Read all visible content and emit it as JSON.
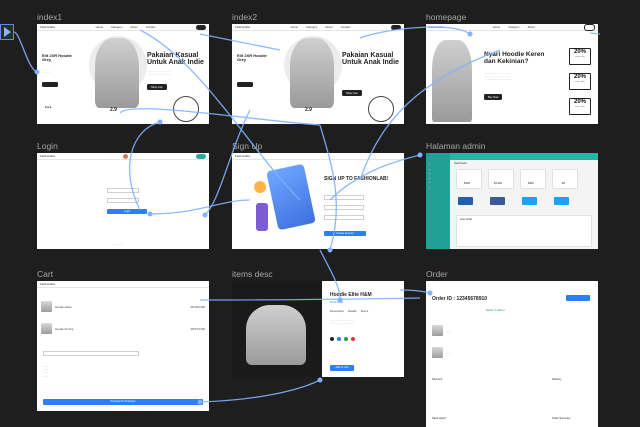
{
  "frames": {
    "index1": {
      "label": "index1"
    },
    "index2": {
      "label": "index2"
    },
    "homepage": {
      "label": "homepage"
    },
    "login": {
      "label": "Login"
    },
    "signup": {
      "label": "Sign Up"
    },
    "admin": {
      "label": "Halaman admin"
    },
    "cart": {
      "label": "Cart"
    },
    "items": {
      "label": "items desc"
    },
    "order": {
      "label": "Order"
    }
  },
  "brand": "Fashionlabs",
  "nav_links": [
    "Home",
    "Category",
    "About",
    "Contact"
  ],
  "hero": {
    "heading": "Pakaian Kasual Untuk Anak Indie",
    "product_small": "Elit 2XR Hoodie Grey",
    "stat_value": "2.9",
    "cta": "Shop now"
  },
  "homepage": {
    "heading": "Nyari Hoodie Keren dan Kekinian?",
    "cta": "Buy Now",
    "badges": [
      {
        "value": "20%",
        "note": "more offer"
      },
      {
        "value": "20%",
        "note": "more offer"
      },
      {
        "value": "20%",
        "note": "more offer"
      }
    ]
  },
  "signup": {
    "heading": "SIGN UP TO FASHIONLAB!",
    "button": "Create account"
  },
  "login": {
    "button": "Login"
  },
  "admin": {
    "title": "Dashboard",
    "stats": [
      "$328",
      "$4,330",
      "$446",
      "$0"
    ],
    "chart_title": "Line Chart"
  },
  "cart": {
    "items": [
      {
        "name": "Hoodie Hitam",
        "price": "RP.250,000"
      },
      {
        "name": "Hoodie Kuning",
        "price": "RP.670,000"
      }
    ],
    "button": "Proceed To Checkout"
  },
  "items_desc": {
    "title": "Hoodie Elite H&M",
    "price": "$1,010,000",
    "tabs": [
      "Description",
      "Details",
      "Specs"
    ],
    "button": "Add to Cart"
  },
  "order": {
    "id_label": "Order ID : 12345678910",
    "status": "Ready to deliver",
    "sections": [
      "Payment",
      "Delivery",
      "Need Help?",
      "Order Summary"
    ]
  }
}
